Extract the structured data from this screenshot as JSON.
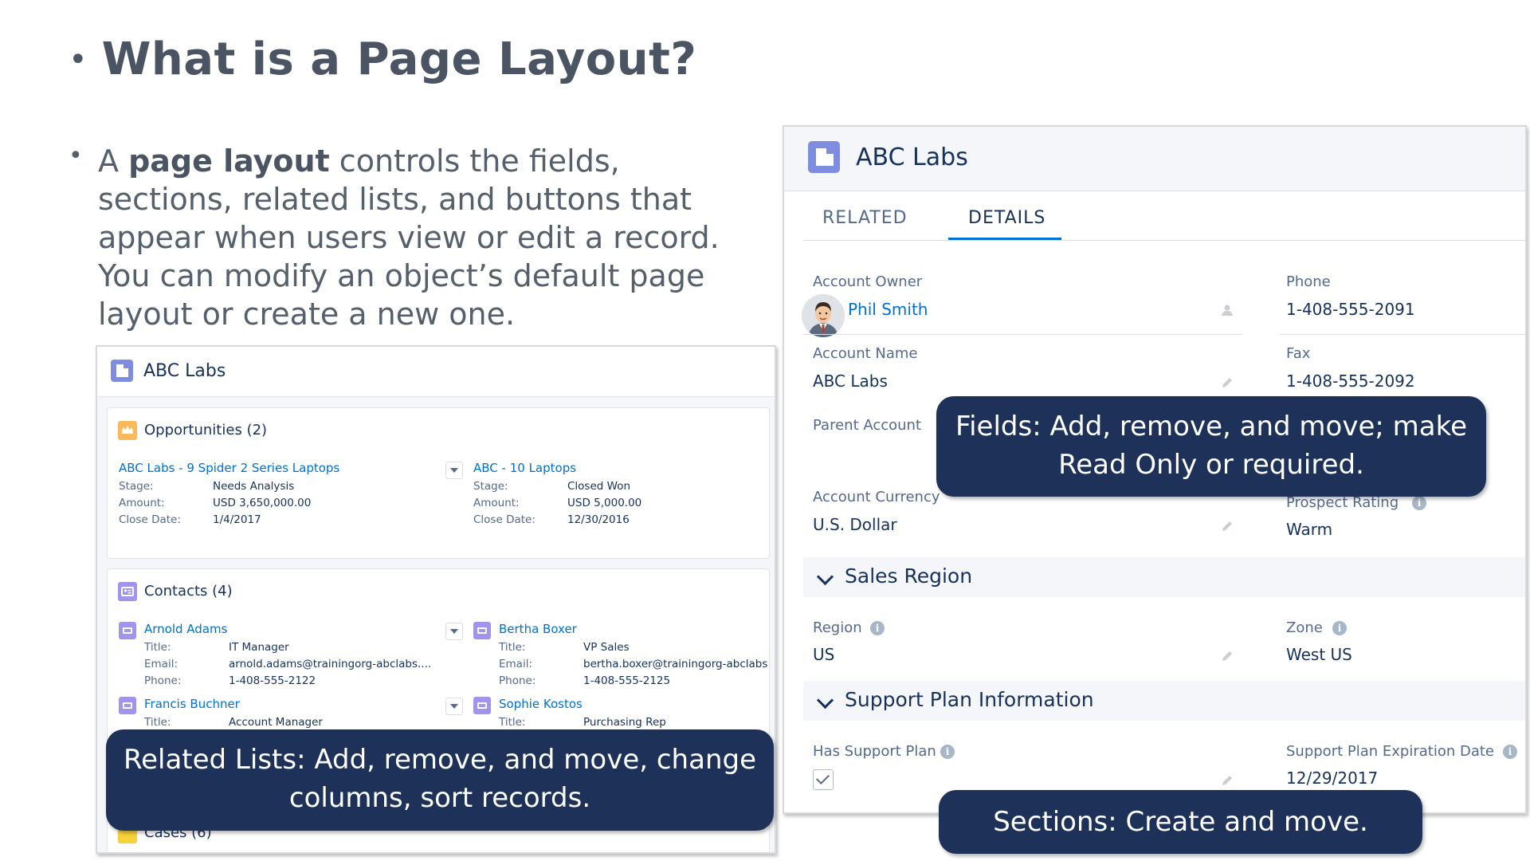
{
  "slide": {
    "title": "What is a Page Layout?",
    "bullet": "•",
    "paragraph": {
      "prefix": "A ",
      "bold": "page layout",
      "rest": " controls the fields, sections, related lists, and buttons that appear when users view or edit a record. You can modify an object’s default page layout or create a new one."
    }
  },
  "left_panel": {
    "title": "ABC Labs",
    "opportunities": {
      "title": "Opportunities (2)",
      "records": [
        {
          "name": "ABC Labs - 9 Spider 2 Series Laptops",
          "stage_label": "Stage:",
          "stage": "Needs Analysis",
          "amount_label": "Amount:",
          "amount": "USD 3,650,000.00",
          "close_label": "Close Date:",
          "close": "1/4/2017"
        },
        {
          "name": "ABC - 10 Laptops",
          "stage_label": "Stage:",
          "stage": "Closed Won",
          "amount_label": "Amount:",
          "amount": "USD 5,000.00",
          "close_label": "Close Date:",
          "close": "12/30/2016"
        }
      ]
    },
    "contacts": {
      "title": "Contacts (4)",
      "records": [
        {
          "name": "Arnold Adams",
          "title_label": "Title:",
          "title": "IT Manager",
          "email_label": "Email:",
          "email": "arnold.adams@trainingorg-abclabs....",
          "phone_label": "Phone:",
          "phone": "1-408-555-2122"
        },
        {
          "name": "Bertha Boxer",
          "title_label": "Title:",
          "title": "VP Sales",
          "email_label": "Email:",
          "email": "bertha.boxer@trainingorg-abclabs",
          "phone_label": "Phone:",
          "phone": "1-408-555-2125"
        },
        {
          "name": "Francis Buchner",
          "title_label": "Title:",
          "title": "Account Manager"
        },
        {
          "name": "Sophie Kostos",
          "title_label": "Title:",
          "title": "Purchasing Rep"
        }
      ]
    },
    "cases": {
      "title": "Cases (6)"
    }
  },
  "right_panel": {
    "title": "ABC Labs",
    "tabs": [
      {
        "label": "RELATED"
      },
      {
        "label": "DETAILS"
      }
    ],
    "fields": {
      "account_owner": {
        "label": "Account Owner",
        "value": "Phil Smith"
      },
      "phone": {
        "label": "Phone",
        "value": "1-408-555-2091"
      },
      "account_name": {
        "label": "Account Name",
        "value": "ABC Labs"
      },
      "fax": {
        "label": "Fax",
        "value": "1-408-555-2092"
      },
      "parent_account": {
        "label": "Parent Account",
        "value": ""
      },
      "account_currency": {
        "label": "Account Currency",
        "value": "U.S. Dollar"
      },
      "prospect_rating": {
        "label": "Prospect Rating",
        "value": "Warm"
      },
      "region": {
        "label": "Region",
        "value": "US"
      },
      "zone": {
        "label": "Zone",
        "value": "West US"
      },
      "has_support_plan": {
        "label": "Has Support Plan",
        "checked": true
      },
      "support_plan_expiration": {
        "label": "Support Plan Expiration Date",
        "value": "12/29/2017"
      }
    },
    "sections": [
      {
        "title": "Sales Region"
      },
      {
        "title": "Support Plan Information"
      }
    ]
  },
  "callouts": {
    "fields": [
      "Fields: Add, remove, and move; make",
      "Read Only or required."
    ],
    "related_lists": [
      "Related Lists: Add, remove, and move, change",
      "columns, sort records."
    ],
    "sections": [
      "Sections:  Create and move."
    ]
  },
  "colors": {
    "callout_bg": "#1e3259",
    "link": "#0070d2",
    "title_text": "#4a5463"
  }
}
